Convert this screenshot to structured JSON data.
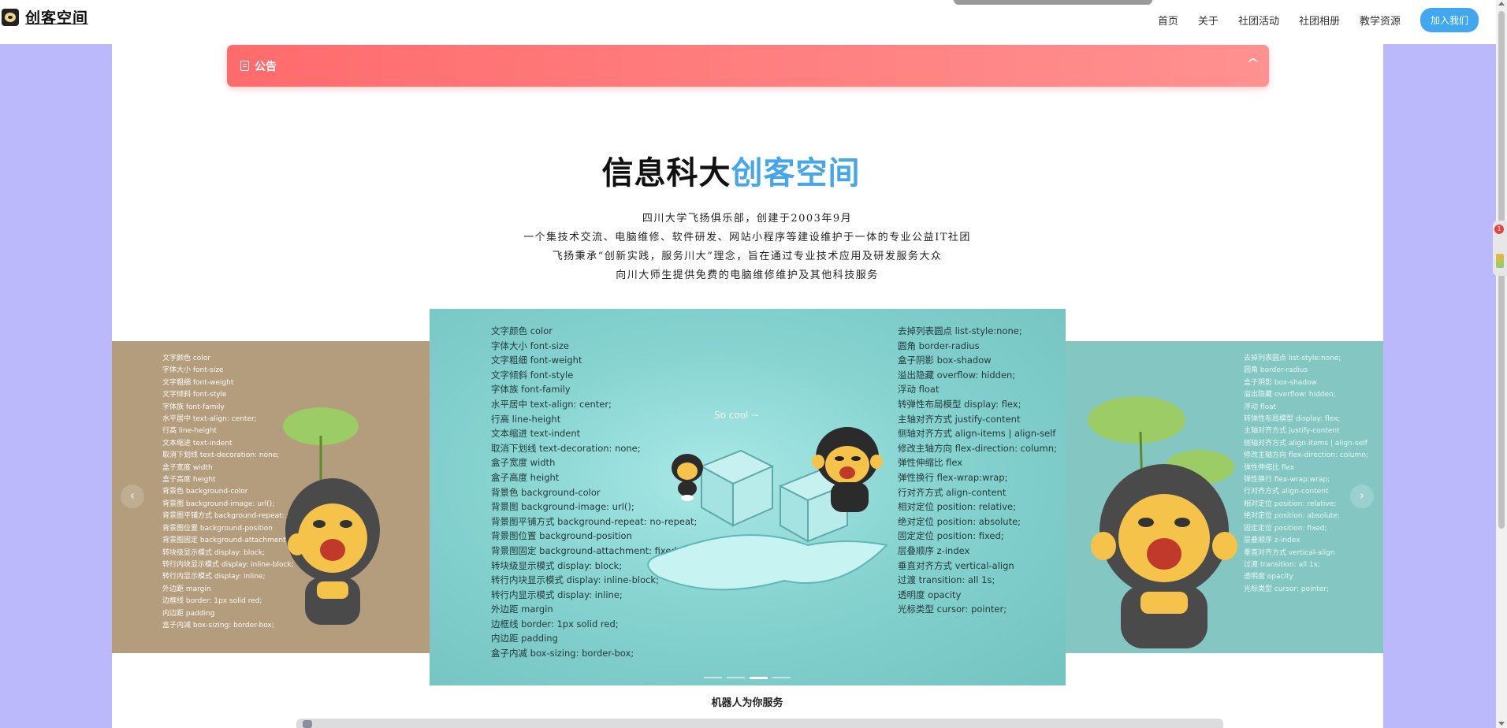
{
  "header": {
    "brand": "创客空间",
    "nav": [
      "首页",
      "关于",
      "社团活动",
      "社团相册",
      "教学资源"
    ],
    "join_button": "加入我们"
  },
  "notice": {
    "title": "公告",
    "icon": "document-icon",
    "chevron": "chevron-up-icon"
  },
  "hero": {
    "title_black": "信息科大",
    "title_blue": "创客空间",
    "accent_color": "#45a6ea",
    "lines": [
      "四川大学飞扬俱乐部，创建于2003年9月",
      "一个集技术交流、电脑维修、软件研发、网站小程序等建设维护于一体的专业公益IT社团",
      "飞扬秉承“创新实践，服务川大”理念，旨在通过专业技术应用及研发服务大众",
      "向川大师生提供免费的电脑维修维护及其他科技服务"
    ]
  },
  "carousel": {
    "center_caption": "So cool ~",
    "active_index": 2,
    "dot_count": 4,
    "css_left": [
      "文字颜色 color",
      "字体大小 font-size",
      "文字粗细 font-weight",
      "文字倾斜 font-style",
      "字体族 font-family",
      "水平居中 text-align: center;",
      "行高 line-height",
      "文本缩进 text-indent",
      "取消下划线 text-decoration: none;",
      "盒子宽度 width",
      "盒子高度 height",
      "背景色 background-color",
      "背景图 background-image: url();",
      "背景图平铺方式 background-repeat: no-repeat;",
      "背景图位置 background-position",
      "背景图固定 background-attachment: fixed;",
      "转块级显示模式 display: block;",
      "转行内块显示模式 display: inline-block;",
      "转行内显示模式 display: inline;",
      "外边距 margin",
      "边框线 border: 1px solid red;",
      "内边距 padding",
      "盒子内减 box-sizing: border-box;"
    ],
    "css_right": [
      "去掉列表圆点 list-style:none;",
      "圆角 border-radius",
      "盒子阴影 box-shadow",
      "溢出隐藏 overflow: hidden;",
      "浮动 float",
      "转弹性布局模型 display: flex;",
      "主轴对齐方式 justify-content",
      "侧轴对齐方式 align-items | align-self",
      "修改主轴方向 flex-direction: column;",
      "弹性伸缩比 flex",
      "弹性换行 flex-wrap:wrap;",
      "行对齐方式 align-content",
      "相对定位 position: relative;",
      "绝对定位 position: absolute;",
      "固定定位 position: fixed;",
      "层叠顺序 z-index",
      "垂直对齐方式 vertical-align",
      "过渡 transition: all 1s;",
      "透明度 opacity",
      "光标类型 cursor: pointer;"
    ]
  },
  "robot": {
    "title": "机器人为你服务"
  },
  "side_widget": {
    "badge": "1"
  },
  "colors": {
    "page_bg": "#bbb8fb",
    "notice_from": "#ff6b6d",
    "notice_to": "#ff9190",
    "join_button": "#41a7f0"
  }
}
